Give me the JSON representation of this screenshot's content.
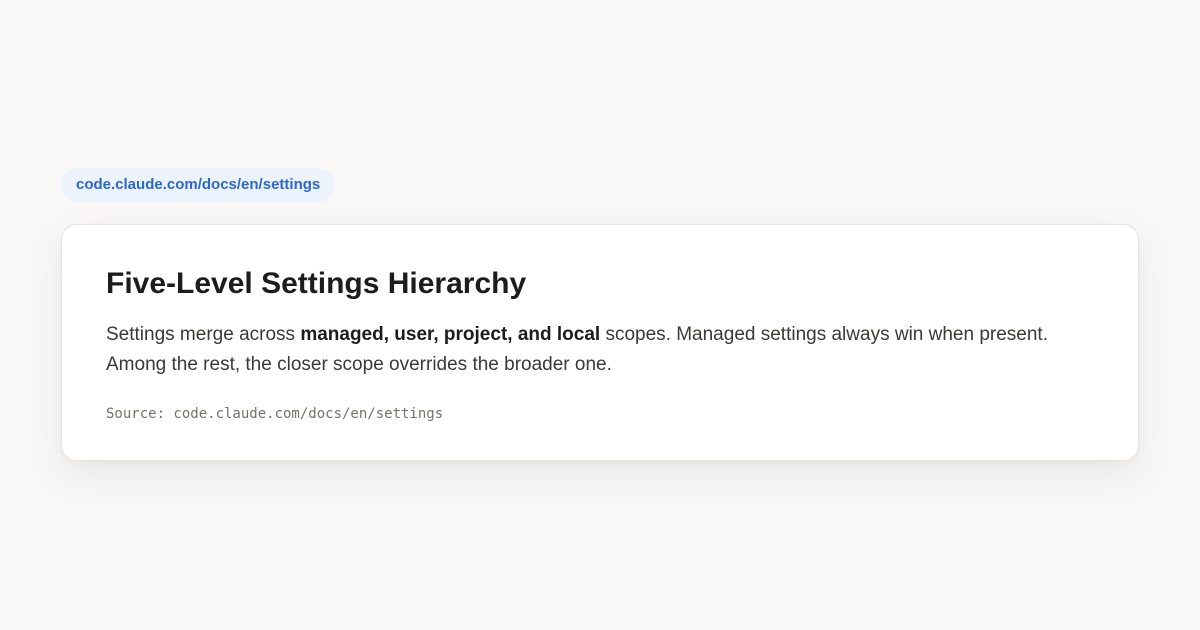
{
  "url_pill": {
    "text": "code.claude.com/docs/en/settings"
  },
  "card": {
    "title": "Five-Level Settings Hierarchy",
    "body": {
      "before": "Settings merge across ",
      "emphasis": "managed, user, project, and local",
      "after": " scopes. Managed settings always win when present. Among the rest, the closer scope overrides the broader one."
    },
    "source": "Source: code.claude.com/docs/en/settings"
  },
  "colors": {
    "page_background": "#f9f8f6",
    "card_background": "#ffffff",
    "url_pill_background": "#edf3fc",
    "url_pill_text": "#2b68c8",
    "title_text": "#1d1c1a",
    "body_text": "#3b3936",
    "source_text": "#75726c"
  }
}
